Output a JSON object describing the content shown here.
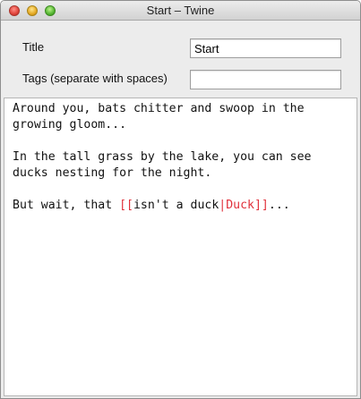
{
  "window": {
    "title": "Start – Twine"
  },
  "form": {
    "title_label": "Title",
    "title_value": "Start",
    "tags_label": "Tags (separate with spaces)",
    "tags_value": ""
  },
  "editor": {
    "paragraph1": "Around you, bats chitter and swoop in the growing gloom...",
    "paragraph2": "In the tall grass by the lake, you can see ducks nesting for the night.",
    "paragraph3_prefix": "But wait, that ",
    "link_open": "[[",
    "link_text": "isn't a duck",
    "link_separator": "|",
    "link_target": "Duck",
    "link_close": "]]",
    "paragraph3_suffix": "..."
  },
  "colors": {
    "link": "#e0303a"
  }
}
